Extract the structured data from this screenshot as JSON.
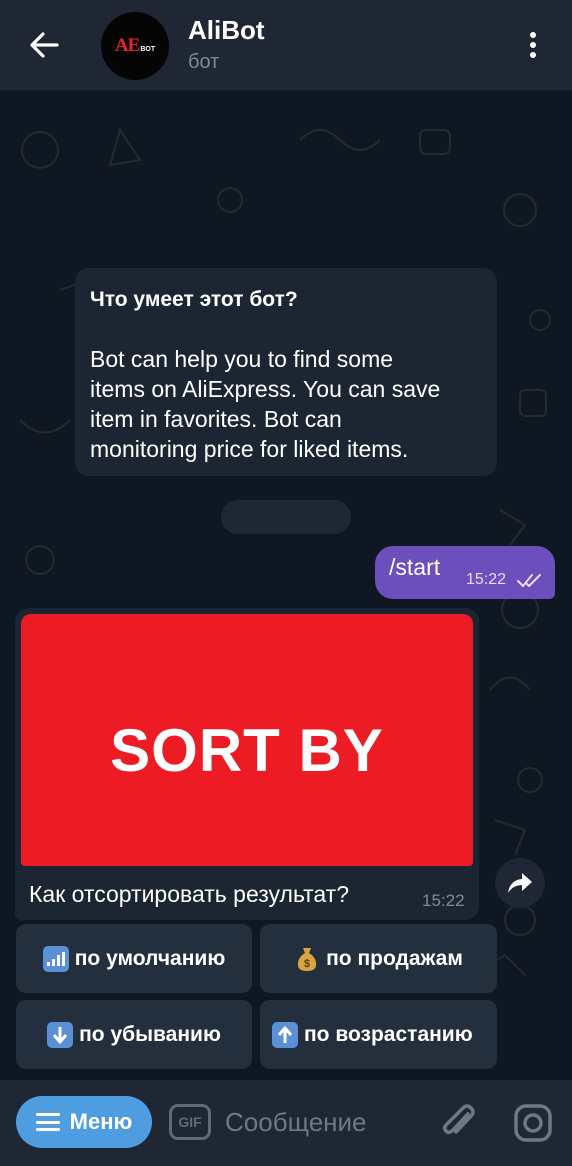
{
  "header": {
    "back_icon": "arrow-left-icon",
    "avatar_logo_main": "AE",
    "avatar_logo_sub": "BOT",
    "title": "AliBot",
    "subtitle": "бот",
    "more_icon": "more-vertical-icon"
  },
  "chat": {
    "intro": {
      "title": "Что умеет этот бот?",
      "text": "Bot can help you to find  some\nitems on AliExpress. You can save\nitem in favorites. Bot can\nmonitoring price for liked items."
    },
    "outgoing": {
      "text": "/start",
      "time": "15:22",
      "status_icon": "double-check-icon"
    },
    "photo_message": {
      "image_text": "SORT BY",
      "image_bg": "#ed1c24",
      "caption": "Как отсортировать результат?",
      "time": "15:22",
      "share_icon": "share-arrow-icon"
    },
    "keyboard": [
      {
        "label": "по умолчанию",
        "icon": "bar-chart-icon",
        "emoji": "📶"
      },
      {
        "label": "по продажам",
        "icon": "money-bag-icon",
        "emoji": "💰"
      },
      {
        "label": "по убыванию",
        "icon": "arrow-down-icon",
        "emoji": "⬇"
      },
      {
        "label": "по возрастанию",
        "icon": "arrow-up-icon",
        "emoji": "⬆"
      }
    ]
  },
  "input_bar": {
    "menu_label": "Меню",
    "gif_label": "GIF",
    "placeholder": "Сообщение",
    "attach_icon": "paperclip-icon",
    "camera_icon": "instagram-camera-icon"
  },
  "colors": {
    "header_bg": "#1e2733",
    "chat_bg": "#0f1722",
    "outgoing_bubble": "#6c4ebd",
    "incoming_bubble": "#1c2633",
    "menu_button": "#4e9de1"
  }
}
